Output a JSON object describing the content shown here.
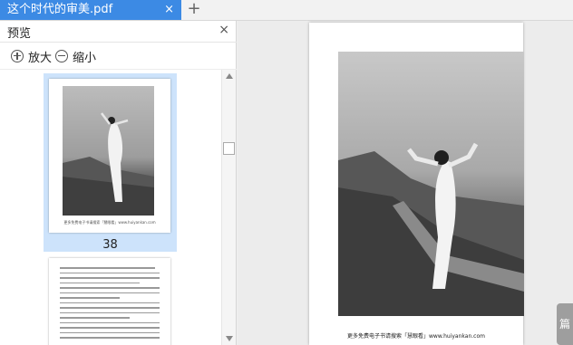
{
  "tab": {
    "title": "这个时代的审美.pdf",
    "close": "×",
    "new": "+"
  },
  "sidebar": {
    "title": "预览",
    "close": "×",
    "zoom_in": "放大",
    "zoom_out": "缩小",
    "thumbnails": [
      {
        "page": "38",
        "selected": true,
        "caption": "更多免费电子书请搜索「慧眼看」www.huiyankan.com"
      },
      {
        "page": "",
        "selected": false
      }
    ]
  },
  "document": {
    "caption": "更多免费电子书请搜索「慧眼看」www.huiyankan.com"
  },
  "side_tab": {
    "label": "篇"
  },
  "colors": {
    "tab_active": "#3c8ae4",
    "thumb_selected": "#cde3fb"
  }
}
